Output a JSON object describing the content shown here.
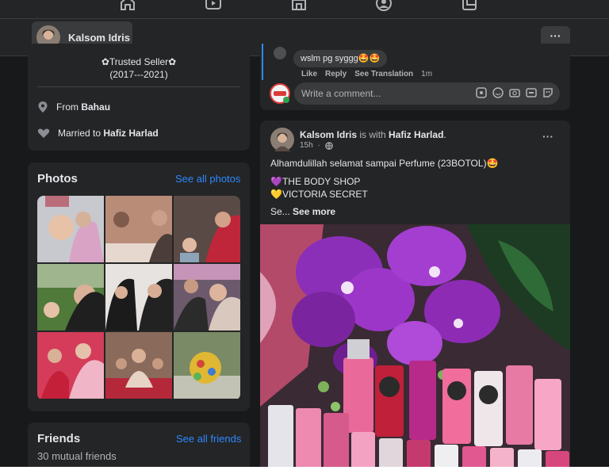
{
  "colors": {
    "bg": "#18191a",
    "card": "#242526",
    "accent": "#2d88ff",
    "muted": "#b0b3b8"
  },
  "topnav": {
    "icons": [
      "home-icon",
      "watch-icon",
      "marketplace-icon",
      "groups-icon",
      "gaming-icon"
    ]
  },
  "profile_bar": {
    "name": "Kalsom Idris",
    "more_label": "···"
  },
  "intro": {
    "line1": "✿Trusted Seller✿",
    "line2": "(2017---2021)",
    "from_prefix": "From ",
    "from_place": "Bahau",
    "married_prefix": "Married to ",
    "married_name": "Hafiz Harlad"
  },
  "photos": {
    "title": "Photos",
    "see_all": "See all photos"
  },
  "friends": {
    "title": "Friends",
    "see_all": "See all friends",
    "mutual": "30 mutual friends"
  },
  "comment": {
    "text": "wslm pg syggg🤩🤩",
    "like": "Like",
    "reply": "Reply",
    "see_translation": "See Translation",
    "time": "1m",
    "placeholder": "Write a comment..."
  },
  "post": {
    "author": "Kalsom Idris",
    "with_text": " is with ",
    "tagged": "Hafiz Harlad",
    "period": ".",
    "time": "15h",
    "sep": " · ",
    "line1": "Alhamdulillah selamat sampai Perfume (23BOTOL)🤩",
    "line2": "💜THE BODY SHOP",
    "line3": "💛VICTORIA SECRET",
    "ellipsis": "Se... ",
    "see_more": "See more",
    "more_label": "···"
  }
}
